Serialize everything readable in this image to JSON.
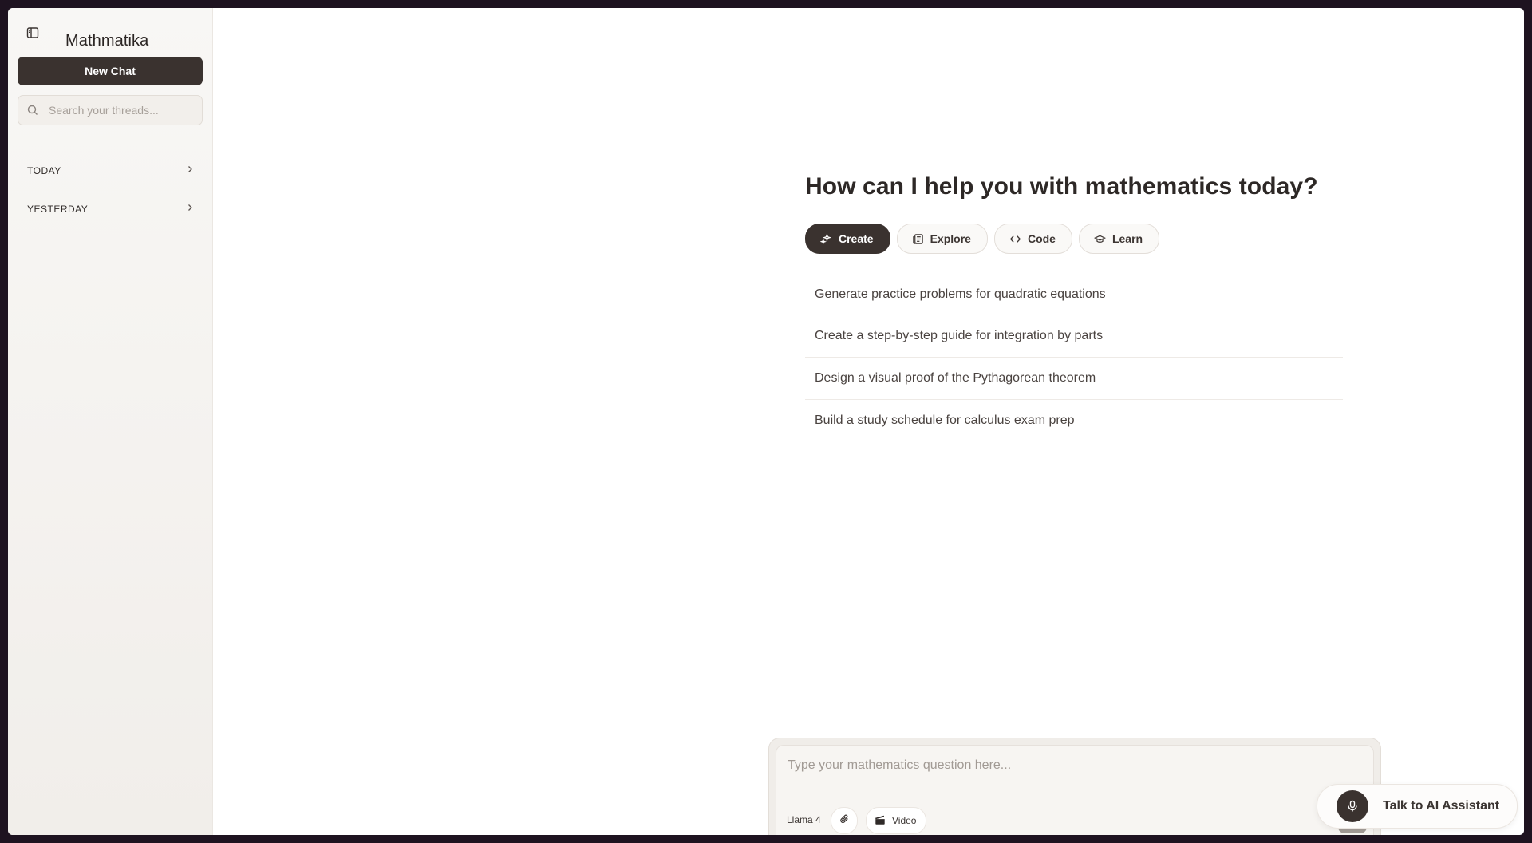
{
  "sidebar": {
    "toggle_icon": "sidebar-toggle-icon",
    "app_title": "Mathmatika",
    "new_chat_label": "New Chat",
    "search": {
      "placeholder": "Search your threads...",
      "value": "",
      "icon": "search-icon"
    },
    "sections": [
      {
        "label": "TODAY",
        "icon": "chevron-right-icon"
      },
      {
        "label": "YESTERDAY",
        "icon": "chevron-right-icon"
      }
    ]
  },
  "main": {
    "heading": "How can I help you with mathematics today?",
    "tabs": [
      {
        "label": "Create",
        "icon": "sparkles-icon",
        "active": true
      },
      {
        "label": "Explore",
        "icon": "newspaper-icon",
        "active": false
      },
      {
        "label": "Code",
        "icon": "code-icon",
        "active": false
      },
      {
        "label": "Learn",
        "icon": "graduation-cap-icon",
        "active": false
      }
    ],
    "suggestions": [
      "Generate practice problems for quadratic equations",
      "Create a step-by-step guide for integration by parts",
      "Design a visual proof of the Pythagorean theorem",
      "Build a study schedule for calculus exam prep"
    ]
  },
  "composer": {
    "placeholder": "Type your mathematics question here...",
    "value": "",
    "model": "Llama 4",
    "attach_icon": "paperclip-icon",
    "video_label": "Video",
    "video_icon": "clapperboard-icon",
    "send_icon": "arrow-up-icon"
  },
  "voice": {
    "label": "Talk to AI Assistant",
    "icon": "microphone-icon"
  },
  "colors": {
    "accent_dark": "#3a322f",
    "sidebar_bg": "#f4f2ef",
    "send_disabled": "#a39c97"
  }
}
